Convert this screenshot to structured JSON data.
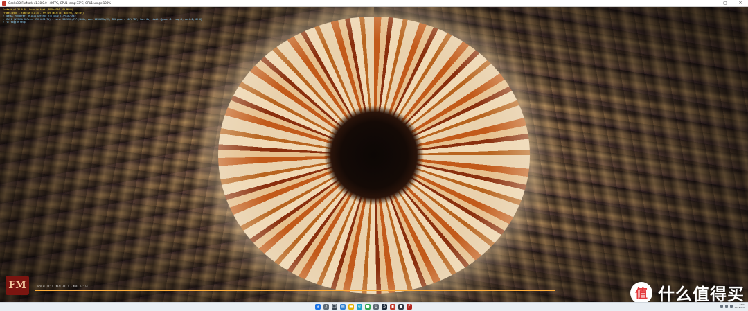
{
  "window": {
    "title": "Geeks3D FurMark v1.38.0.0 - 4KFPS, GPU1 temp:73°C, GPU1 usage:100%",
    "controls": {
      "minimize": "—",
      "maximize": "▢",
      "close": "✕"
    }
  },
  "overlay": {
    "line1": "FurMark v1.38.0.0 - Burn-in test, 3840x2160 (0X MSAA)",
    "line2": "Frames:5926 - time:00:01:15 - FPS:89 (min:76, max:90, avg:89)",
    "line3": "> OpenGL renderer: NVIDIA GeForce RTX 4070 Ti/PCIe/SSE2",
    "line4": "> GPU 1 (NVIDIA GeForce RTX 4070 Ti) - core: 2805MHz/73°C/100%, mem: 10501MHz/8%, GPU power: 100% TDP, fan: 0%, limits:[power:1, temp:0, volt:0, OV:0]",
    "line5": "> F1: toggle help"
  },
  "monitor": {
    "logo_text": "FM",
    "gpu_label": "GPU 1: 73° C (min: 38° C - max: 73° C)"
  },
  "watermark": {
    "logo_glyph": "值",
    "text": "什么值得买"
  },
  "taskbar": {
    "icons": [
      {
        "name": "windows-start-icon",
        "glyph": "⊞",
        "color": "#1a73e8"
      },
      {
        "name": "search-icon",
        "glyph": "⌕",
        "color": "#5f6b77"
      },
      {
        "name": "task-view-icon",
        "glyph": "❐",
        "color": "#3b4754"
      },
      {
        "name": "widgets-icon",
        "glyph": "▤",
        "color": "#2f7fd0"
      },
      {
        "name": "file-explorer-icon",
        "glyph": "▬",
        "color": "#e6b000"
      },
      {
        "name": "edge-icon",
        "glyph": "e",
        "color": "#1aa1c9"
      },
      {
        "name": "chrome-icon",
        "glyph": "●",
        "color": "#34a853"
      },
      {
        "name": "settings-icon",
        "glyph": "⚙",
        "color": "#5c6670"
      },
      {
        "name": "steam-icon",
        "glyph": "S",
        "color": "#1b2838"
      },
      {
        "name": "app-icon-red",
        "glyph": "▪",
        "color": "#c0392b"
      },
      {
        "name": "app-icon-dark",
        "glyph": "▪",
        "color": "#333a44"
      },
      {
        "name": "furmark-icon",
        "glyph": "F",
        "color": "#b3261e"
      }
    ],
    "tray_time": "14:02",
    "tray_date": "2023/1/19"
  }
}
